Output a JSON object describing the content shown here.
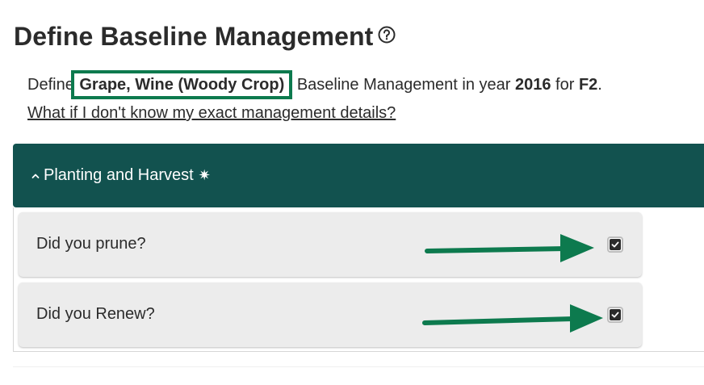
{
  "page": {
    "title": "Define Baseline Management"
  },
  "intro": {
    "prefix": "Define ",
    "crop": "Grape, Wine (Woody Crop)",
    "middle": " Baseline Management in year ",
    "year": "2016",
    "for_text": " for ",
    "field": "F2",
    "suffix": "."
  },
  "help_link": "What if I don't know my exact management details?",
  "section": {
    "label": "Planting and Harvest",
    "star": "✷",
    "expanded": true
  },
  "questions": [
    {
      "label": "Did you prune?",
      "checked": true
    },
    {
      "label": "Did you Renew?",
      "checked": true
    }
  ],
  "colors": {
    "header_bg": "#12524f",
    "highlight": "#0d7a4e",
    "card_bg": "#ececec"
  }
}
